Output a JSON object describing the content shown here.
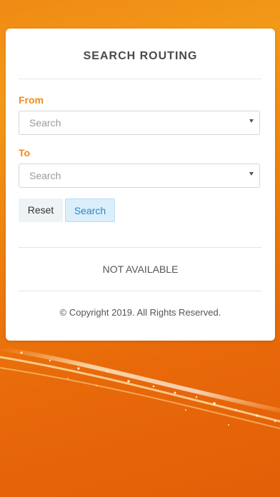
{
  "app": {
    "title": "SEARCH ROUTING"
  },
  "form": {
    "from": {
      "label": "From",
      "placeholder": "Search"
    },
    "to": {
      "label": "To",
      "placeholder": "Search"
    },
    "buttons": {
      "reset_label": "Reset",
      "search_label": "Search"
    }
  },
  "result": {
    "status_text": "NOT AVAILABLE"
  },
  "footer": {
    "copyright": "© Copyright 2019. All Rights Reserved."
  },
  "colors": {
    "accent": "#f18a1c",
    "background": "#ee7f0c",
    "search_button_text": "#2a88c9",
    "card": "#ffffff"
  },
  "icons": {
    "select_arrow": "chevron-down-icon"
  }
}
